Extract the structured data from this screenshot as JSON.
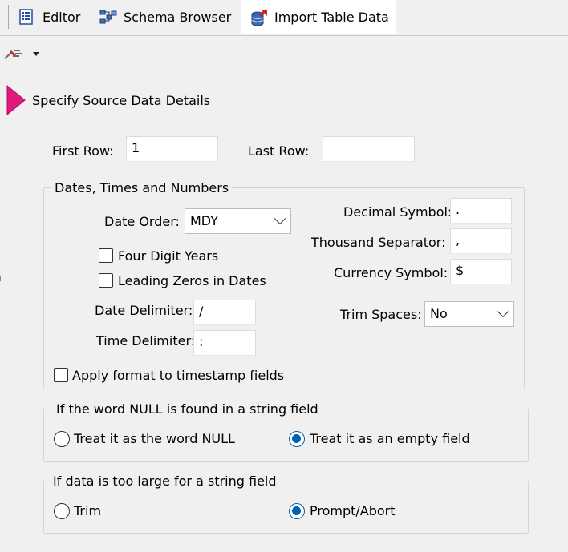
{
  "tabs": [
    {
      "label": "Editor",
      "icon": "editor-icon"
    },
    {
      "label": "Schema Browser",
      "icon": "schema-browser-icon"
    },
    {
      "label": "Import Table Data",
      "icon": "import-table-icon",
      "active": true
    }
  ],
  "toolbar": {
    "connection_icon": "plug-icon",
    "dropdown_icon": "caret-down-icon"
  },
  "section": {
    "title": "Specify Source Data Details",
    "marker_color": "#e0197d"
  },
  "rows": {
    "first_row_label": "First Row:",
    "first_row_value": "1",
    "last_row_label": "Last Row:",
    "last_row_value": ""
  },
  "dates_group": {
    "legend": "Dates, Times and Numbers",
    "date_order_label": "Date Order:",
    "date_order_value": "MDY",
    "four_digit_years_label": "Four Digit Years",
    "four_digit_years_checked": false,
    "leading_zeros_label": "Leading Zeros in Dates",
    "leading_zeros_checked": false,
    "date_delimiter_label": "Date Delimiter:",
    "date_delimiter_value": "/",
    "time_delimiter_label": "Time Delimiter:",
    "time_delimiter_value": ":",
    "apply_format_label": "Apply format to timestamp fields",
    "apply_format_checked": false,
    "decimal_symbol_label": "Decimal Symbol:",
    "decimal_symbol_value": ".",
    "thousand_separator_label": "Thousand Separator:",
    "thousand_separator_value": ",",
    "currency_symbol_label": "Currency Symbol:",
    "currency_symbol_value": "$",
    "trim_spaces_label": "Trim Spaces:",
    "trim_spaces_value": "No"
  },
  "null_group": {
    "legend": "If the word NULL is found in a string field",
    "option_word_null": "Treat it as the word NULL",
    "option_empty_field": "Treat it as an empty field",
    "selected": "empty_field"
  },
  "large_group": {
    "legend": "If data is too large for a string field",
    "option_trim": "Trim",
    "option_prompt": "Prompt/Abort",
    "selected": "prompt"
  },
  "colors": {
    "radio_selected": "#0063b1",
    "background": "#f0f0f0"
  }
}
